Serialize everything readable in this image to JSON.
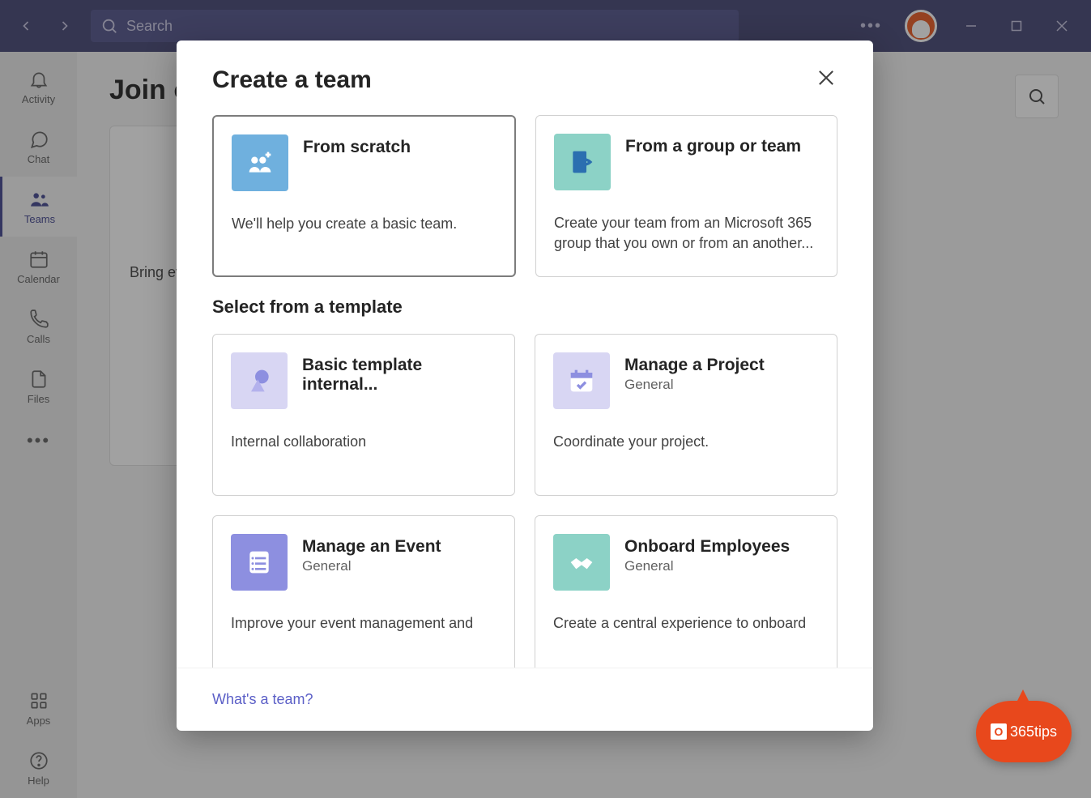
{
  "titlebar": {
    "search_placeholder": "Search"
  },
  "sidebar": {
    "items": [
      {
        "label": "Activity"
      },
      {
        "label": "Chat"
      },
      {
        "label": "Teams"
      },
      {
        "label": "Calendar"
      },
      {
        "label": "Calls"
      },
      {
        "label": "Files"
      }
    ],
    "apps_label": "Apps",
    "help_label": "Help"
  },
  "page": {
    "heading": "Join or create a team",
    "bg_card_text": "Bring everyone together and get to work!"
  },
  "modal": {
    "title": "Create a team",
    "primary": [
      {
        "title": "From scratch",
        "subtitle": "",
        "description": "We'll help you create a basic team.",
        "icon_color": "#6fb0de"
      },
      {
        "title": "From a group or team",
        "subtitle": "",
        "description": "Create your team from an Microsoft 365 group that you own or from an another...",
        "icon_color": "#8cd2c6"
      }
    ],
    "templates_heading": "Select from a template",
    "templates": [
      {
        "title": "Basic template internal...",
        "subtitle": "",
        "description": "Internal collaboration",
        "icon_color": "#d8d6f3"
      },
      {
        "title": "Manage a Project",
        "subtitle": "General",
        "description": "Coordinate your project.",
        "icon_color": "#d8d6f3"
      },
      {
        "title": "Manage an Event",
        "subtitle": "General",
        "description": "Improve your event management and",
        "icon_color": "#8d8fe0"
      },
      {
        "title": "Onboard Employees",
        "subtitle": "General",
        "description": "Create a central experience to onboard",
        "icon_color": "#8cd2c6"
      }
    ],
    "footer_link": "What's a team?"
  },
  "badge": {
    "text": "365tips"
  }
}
